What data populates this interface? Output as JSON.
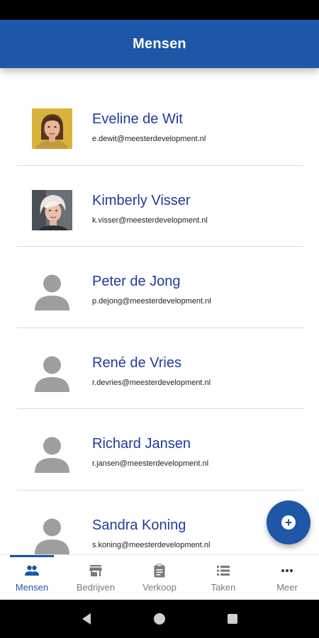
{
  "app_bar": {
    "title": "Mensen"
  },
  "people": [
    {
      "name": "Eveline de Wit",
      "email": "e.dewit@meesterdevelopment.nl",
      "avatar": "photo-eveline"
    },
    {
      "name": "Kimberly Visser",
      "email": "k.visser@meesterdevelopment.nl",
      "avatar": "photo-kimberly"
    },
    {
      "name": "Peter de Jong",
      "email": "p.dejong@meesterdevelopment.nl",
      "avatar": "person-placeholder-icon"
    },
    {
      "name": "René de Vries",
      "email": "r.devries@meesterdevelopment.nl",
      "avatar": "person-placeholder-icon"
    },
    {
      "name": "Richard Jansen",
      "email": "r.jansen@meesterdevelopment.nl",
      "avatar": "person-placeholder-icon"
    },
    {
      "name": "Sandra Koning",
      "email": "s.koning@meesterdevelopment.nl",
      "avatar": "person-placeholder-icon"
    }
  ],
  "fab": {
    "icon": "add-icon"
  },
  "bottom_nav": {
    "items": [
      {
        "label": "Mensen",
        "icon": "people-icon",
        "active": true
      },
      {
        "label": "Bedrijven",
        "icon": "store-icon",
        "active": false
      },
      {
        "label": "Verkoop",
        "icon": "clipboard-icon",
        "active": false
      },
      {
        "label": "Taken",
        "icon": "list-icon",
        "active": false
      },
      {
        "label": "Meer",
        "icon": "more-icon",
        "active": false
      }
    ]
  },
  "system_nav": {
    "icons": [
      "back-icon",
      "home-icon",
      "recents-icon"
    ]
  },
  "colors": {
    "primary": "#1e56a8",
    "name_text": "#1f3c9c",
    "inactive": "#7a7a7a",
    "placeholder_avatar": "#9e9e9e"
  }
}
